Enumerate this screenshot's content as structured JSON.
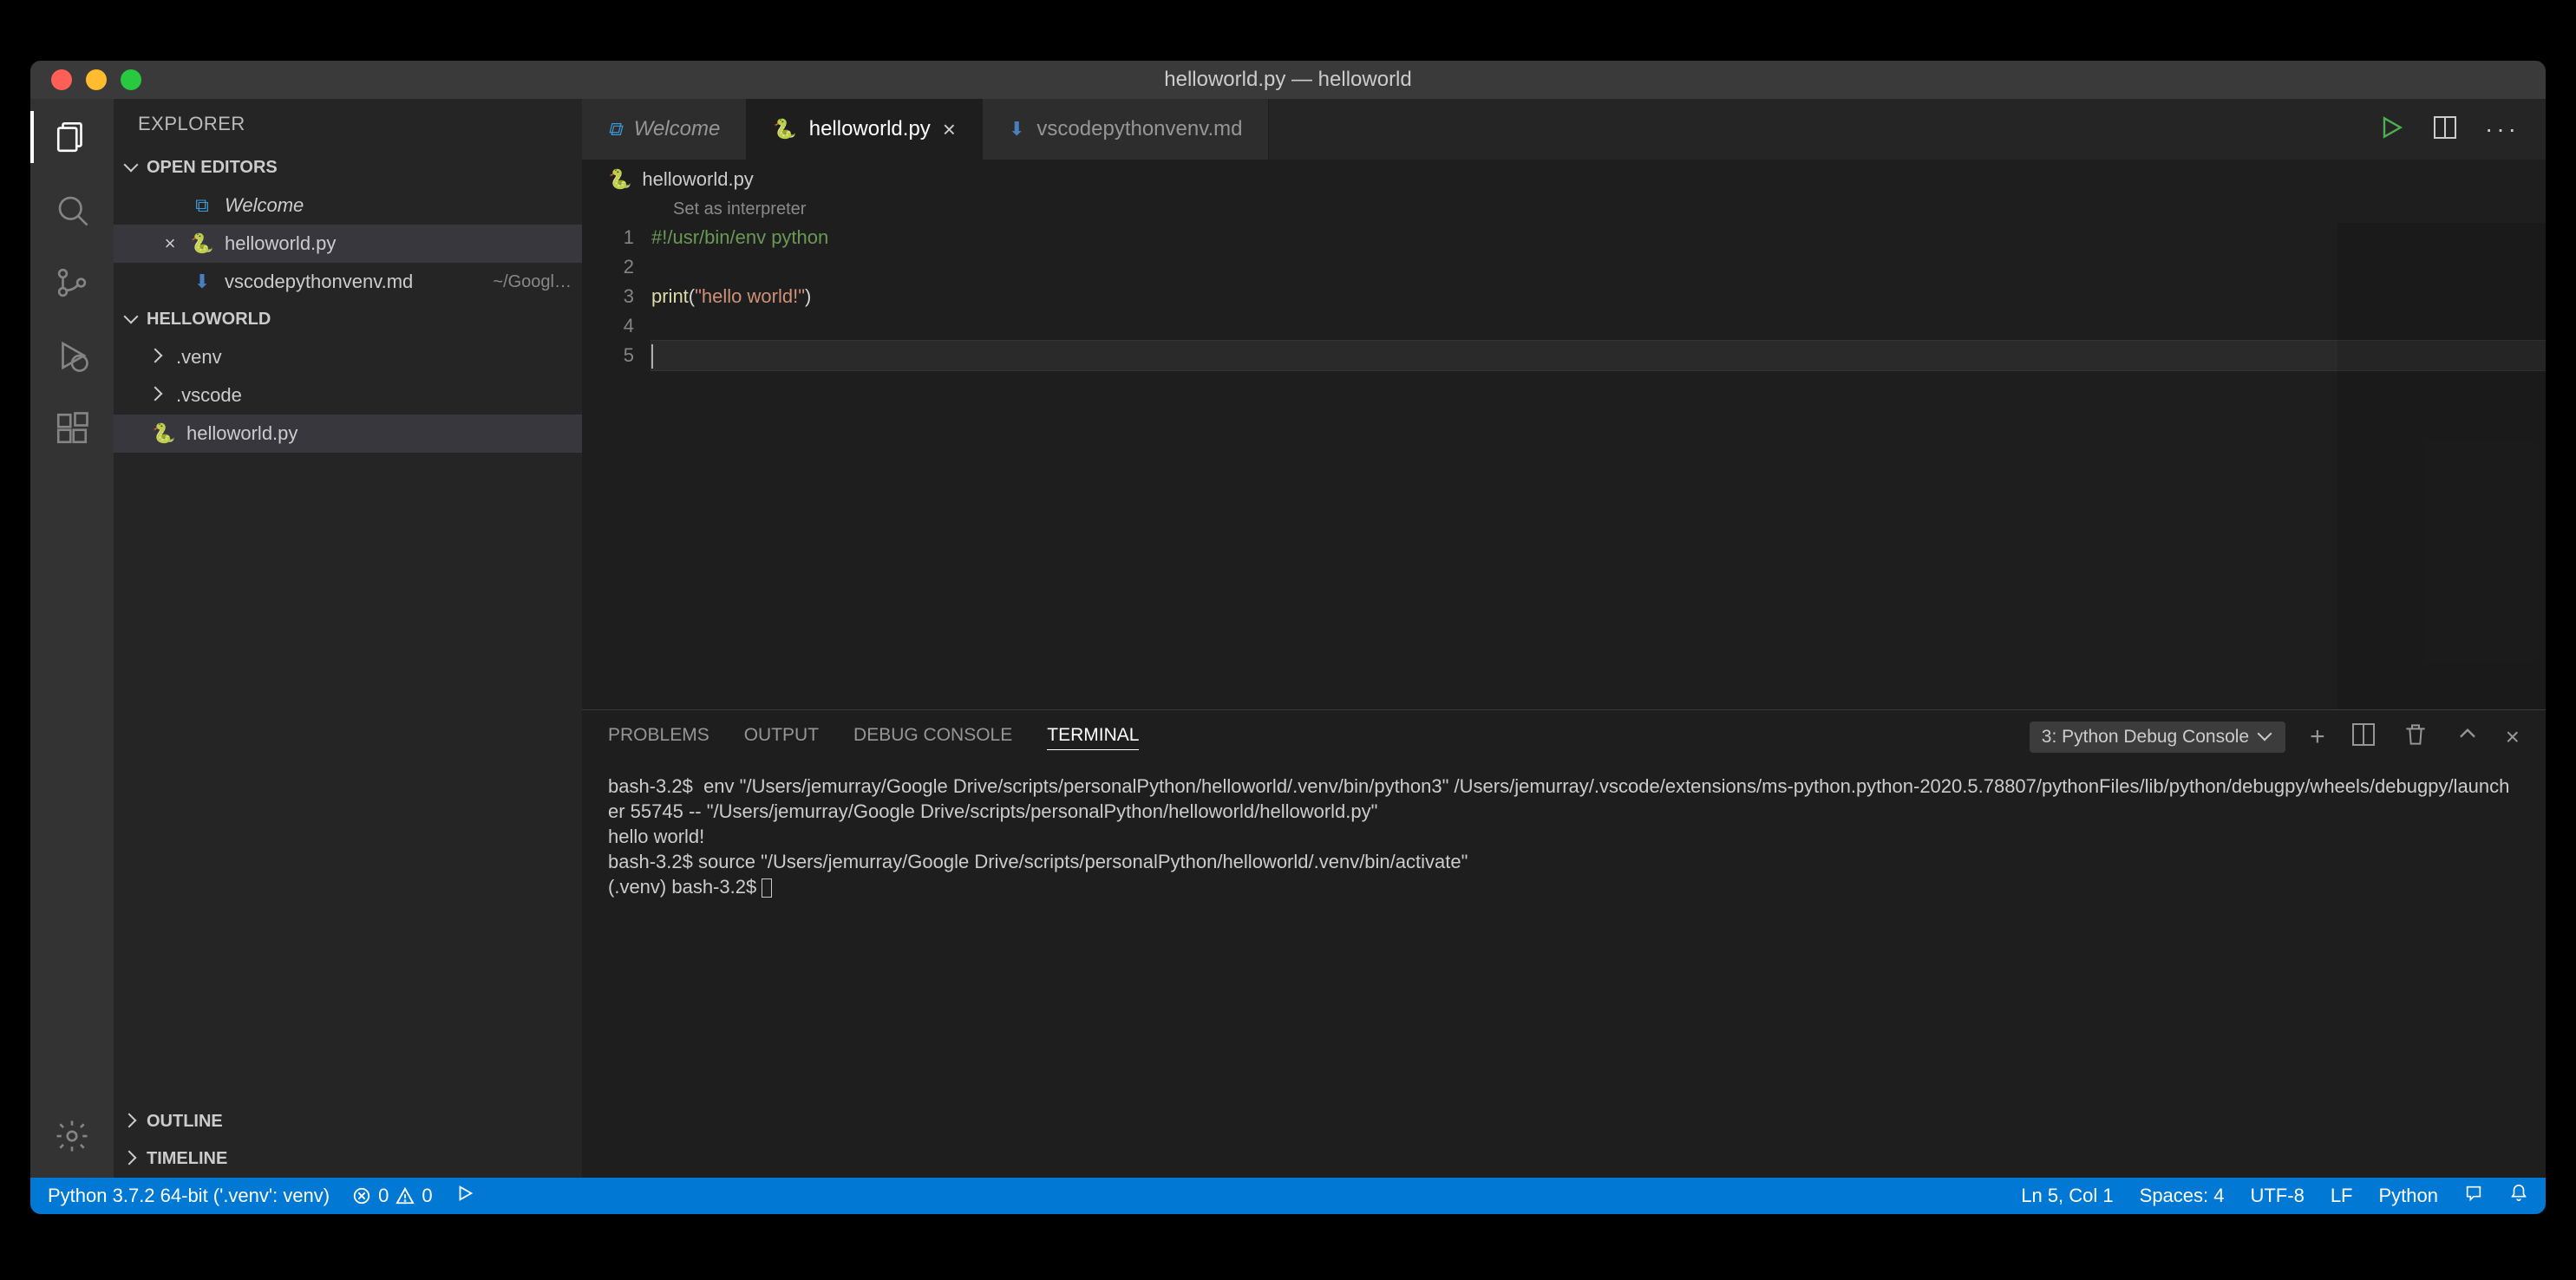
{
  "window_title": "helloworld.py — helloworld",
  "sidebar": {
    "header": "EXPLORER",
    "open_editors_label": "OPEN EDITORS",
    "open_editors": [
      {
        "icon": "vscode",
        "label": "Welcome",
        "italic": true,
        "close": false
      },
      {
        "icon": "python",
        "label": "helloworld.py",
        "close": true
      },
      {
        "icon": "markdown",
        "label": "vscodepythonvenv.md",
        "desc": "~/Googl…",
        "close": false
      }
    ],
    "folder_label": "HELLOWORLD",
    "folder_items": [
      {
        "chev": "right",
        "label": ".venv"
      },
      {
        "chev": "right",
        "label": ".vscode"
      },
      {
        "icon": "python",
        "label": "helloworld.py",
        "sel": true
      }
    ],
    "outline_label": "OUTLINE",
    "timeline_label": "TIMELINE"
  },
  "tabs": [
    {
      "icon": "vscode",
      "label": "Welcome",
      "italic": true,
      "active": false,
      "close": false
    },
    {
      "icon": "python",
      "label": "helloworld.py",
      "active": true,
      "close": true
    },
    {
      "icon": "markdown",
      "label": "vscodepythonvenv.md",
      "active": false,
      "close": false
    }
  ],
  "breadcrumb": {
    "icon": "python",
    "label": "helloworld.py"
  },
  "codelens": "Set as interpreter",
  "code": {
    "lines": [
      {
        "n": 1,
        "html": "<span class='s-comment'>#!/usr/bin/env python</span>"
      },
      {
        "n": 2,
        "html": ""
      },
      {
        "n": 3,
        "html": "<span class='s-fn'>print</span><span class='s-punc'>(</span><span class='s-str'>\"hello world!\"</span><span class='s-punc'>)</span>"
      },
      {
        "n": 4,
        "html": ""
      },
      {
        "n": 5,
        "html": "",
        "current": true
      }
    ]
  },
  "panel": {
    "tabs": [
      "PROBLEMS",
      "OUTPUT",
      "DEBUG CONSOLE",
      "TERMINAL"
    ],
    "active": "TERMINAL",
    "term_select": "3: Python Debug Console",
    "terminal_text": "bash-3.2$  env \"/Users/jemurray/Google Drive/scripts/personalPython/helloworld/.venv/bin/python3\" /Users/jemurray/.vscode/extensions/ms-python.python-2020.5.78807/pythonFiles/lib/python/debugpy/wheels/debugpy/launcher 55745 -- \"/Users/jemurray/Google Drive/scripts/personalPython/helloworld/helloworld.py\"\nhello world!\nbash-3.2$ source \"/Users/jemurray/Google Drive/scripts/personalPython/helloworld/.venv/bin/activate\"\n(.venv) bash-3.2$ "
  },
  "status": {
    "python": "Python 3.7.2 64-bit ('.venv': venv)",
    "errors": "0",
    "warnings": "0",
    "cursor": "Ln 5, Col 1",
    "spaces": "Spaces: 4",
    "encoding": "UTF-8",
    "eol": "LF",
    "lang": "Python"
  }
}
